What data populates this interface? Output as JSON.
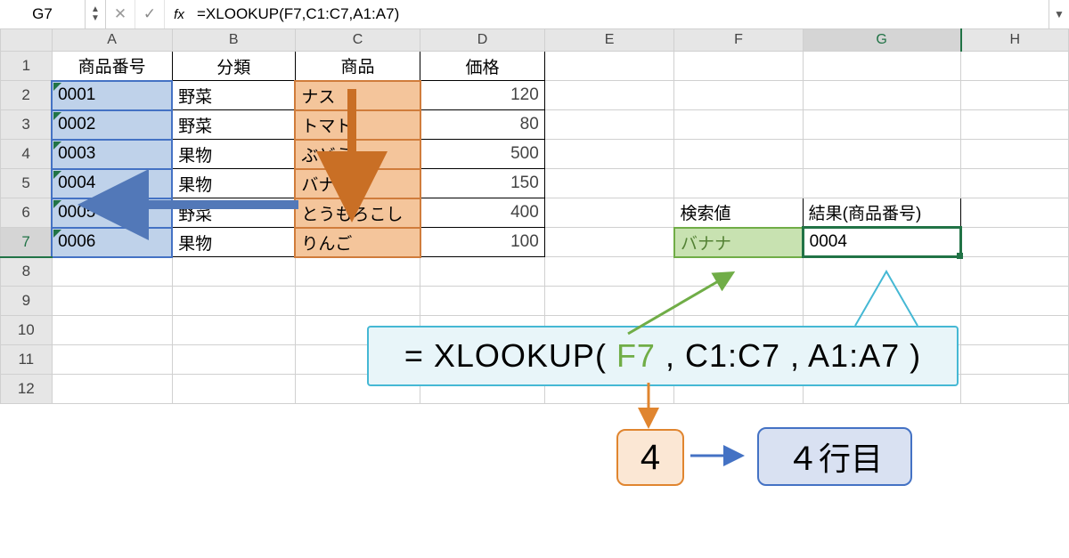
{
  "namebox": "G7",
  "formula_bar": "=XLOOKUP(F7,C1:C7,A1:A7)",
  "columns": [
    "A",
    "B",
    "C",
    "D",
    "E",
    "F",
    "G",
    "H"
  ],
  "rows": [
    "1",
    "2",
    "3",
    "4",
    "5",
    "6",
    "7",
    "8",
    "9",
    "10",
    "11",
    "12"
  ],
  "headers": {
    "A": "商品番号",
    "B": "分類",
    "C": "商品",
    "D": "価格"
  },
  "data": [
    {
      "A": "0001",
      "B": "野菜",
      "C": "ナス",
      "D": "120"
    },
    {
      "A": "0002",
      "B": "野菜",
      "C": "トマト",
      "D": "80"
    },
    {
      "A": "0003",
      "B": "果物",
      "C": "ぶどう",
      "D": "500"
    },
    {
      "A": "0004",
      "B": "果物",
      "C": "バナナ",
      "D": "150"
    },
    {
      "A": "0005",
      "B": "野菜",
      "C": "とうもろこし",
      "D": "400"
    },
    {
      "A": "0006",
      "B": "果物",
      "C": "りんご",
      "D": "100"
    }
  ],
  "lookup": {
    "F6": "検索値",
    "G6": "結果(商品番号)",
    "F7": "バナナ",
    "G7": "0004"
  },
  "formula_parts": {
    "pre": "= XLOOKUP( ",
    "arg1": "F7",
    "sep1": " , ",
    "arg2": "C1:C7",
    "sep2": " , ",
    "arg3": "A1:A7",
    "post": " )"
  },
  "box4": "4",
  "box_row": "４行目",
  "icons": {
    "up": "▲",
    "down": "▼",
    "x": "✕",
    "check": "✓",
    "fx": "fx",
    "drop": "▼"
  }
}
